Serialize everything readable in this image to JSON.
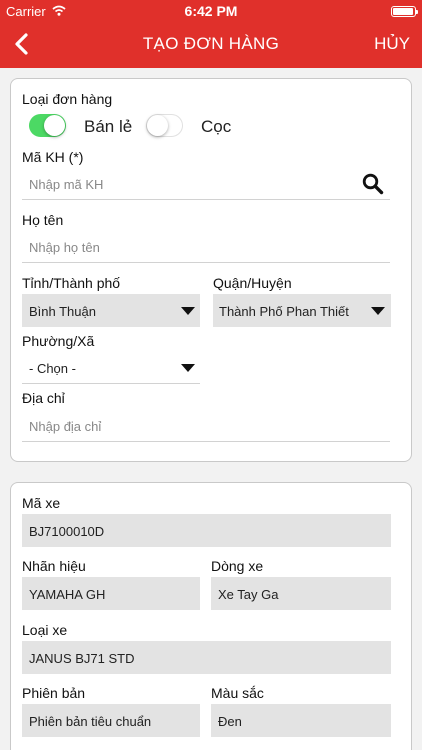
{
  "status_bar": {
    "carrier": "Carrier",
    "time": "6:42 PM"
  },
  "header": {
    "title": "TẠO ĐƠN HÀNG",
    "cancel_label": "HỦY"
  },
  "customer": {
    "order_type_label": "Loại đơn hàng",
    "option_retail": "Bán lẻ",
    "option_retail_on": true,
    "option_deposit": "Cọc",
    "option_deposit_on": false,
    "customer_code_label": "Mã KH (*)",
    "customer_code_placeholder": "Nhập mã KH",
    "full_name_label": "Họ tên",
    "full_name_placeholder": "Nhập họ tên",
    "province_label": "Tỉnh/Thành phố",
    "province_value": "Bình Thuận",
    "district_label": "Quận/Huyện",
    "district_value": "Thành Phố Phan Thiết",
    "ward_label": "Phường/Xã",
    "ward_value": "- Chọn -",
    "address_label": "Địa chỉ",
    "address_placeholder": "Nhập địa chỉ"
  },
  "vehicle": {
    "code_label": "Mã xe",
    "code_value": "BJ7100010D",
    "brand_label": "Nhãn hiệu",
    "brand_value": "YAMAHA GH",
    "line_label": "Dòng xe",
    "line_value": "Xe Tay Ga",
    "type_label": "Loại xe",
    "type_value": "JANUS BJ71 STD",
    "version_label": "Phiên bản",
    "version_value": "Phiên bản tiêu chuẩn",
    "color_label": "Màu sắc",
    "color_value": "Đen"
  },
  "colors": {
    "brand_red": "#e0302b",
    "switch_on": "#4cd964"
  }
}
